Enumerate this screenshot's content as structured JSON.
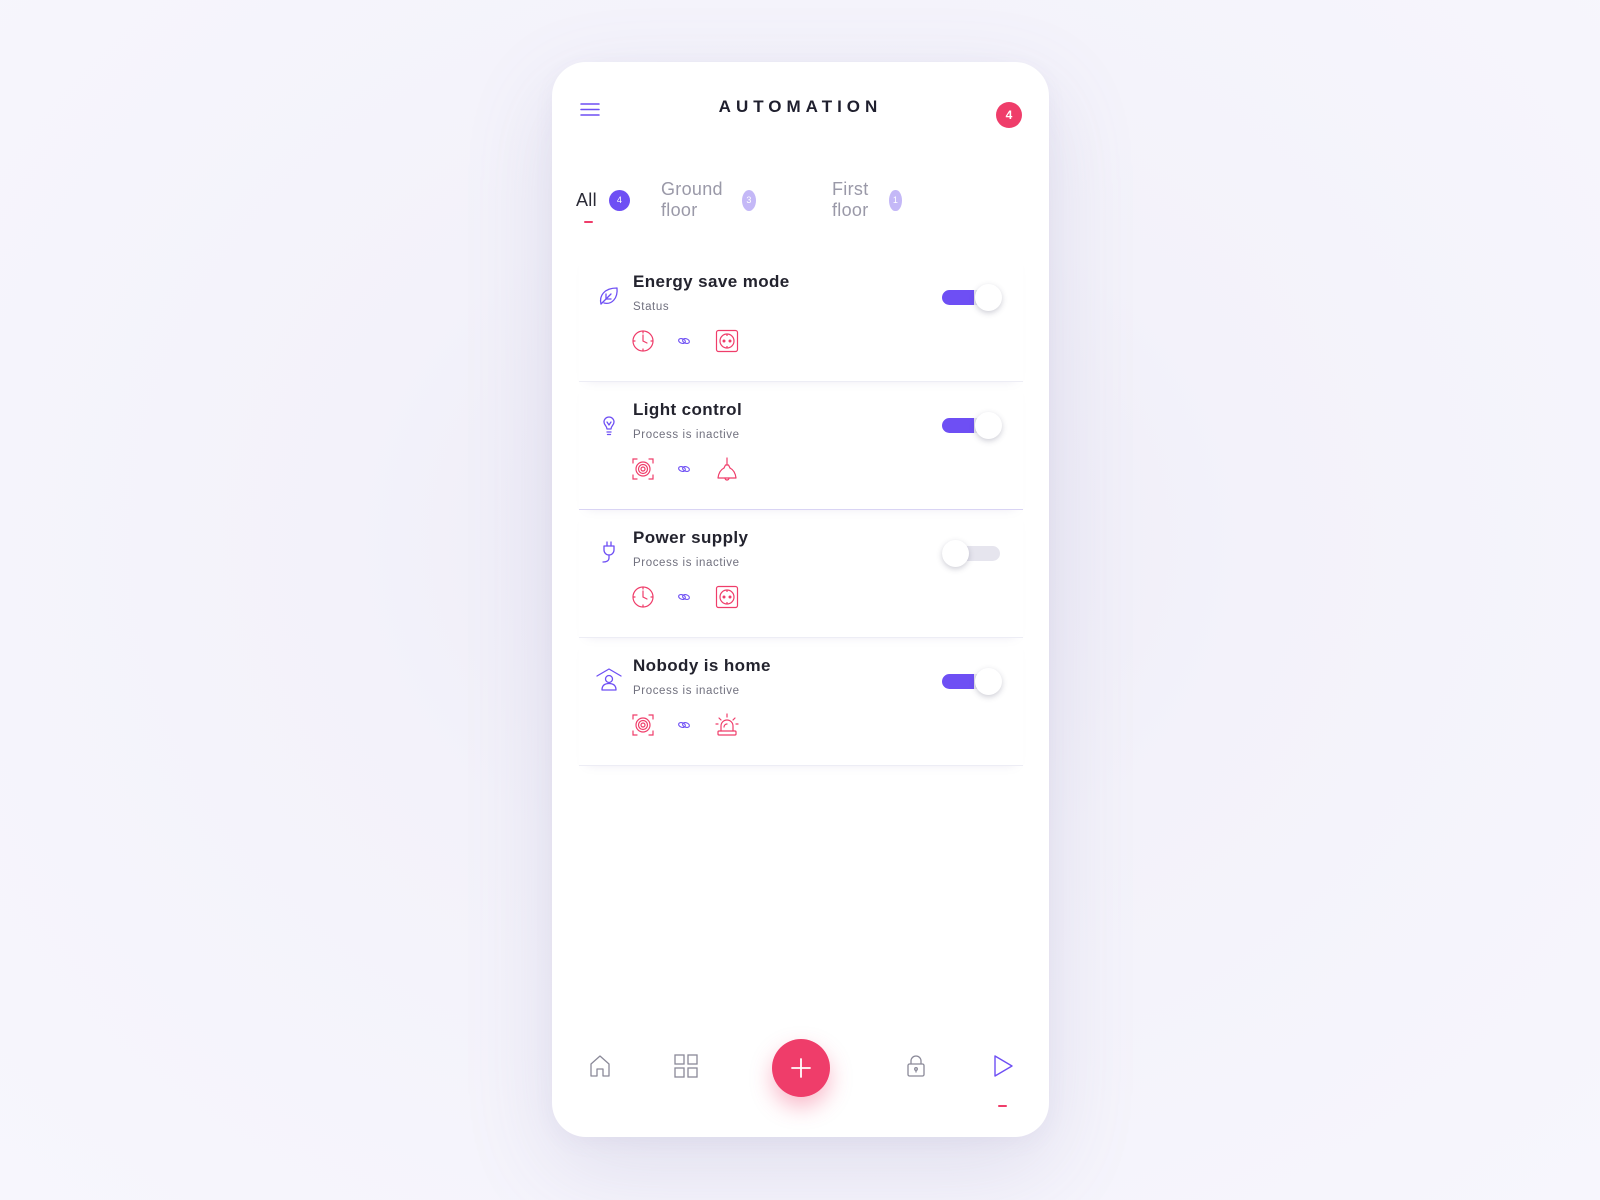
{
  "header": {
    "title": "AUTOMATION",
    "menu_icon": "hamburger-menu-icon",
    "notification_count": "4"
  },
  "tabs": [
    {
      "label": "All",
      "count": "4",
      "active": true
    },
    {
      "label": "Ground floor",
      "count": "3",
      "active": false
    },
    {
      "label": "First floor",
      "count": "1",
      "active": false
    }
  ],
  "automations": [
    {
      "name": "Energy save mode",
      "status": "Status",
      "icon": "leaf-icon",
      "enabled": true,
      "devices": [
        "clock-icon",
        "link-icon",
        "socket-icon"
      ]
    },
    {
      "name": "Light control",
      "status": "Process is inactive",
      "icon": "lightbulb-icon",
      "enabled": true,
      "devices": [
        "motion-sensor-icon",
        "link-icon",
        "lamp-icon"
      ]
    },
    {
      "name": "Power supply",
      "status": "Process is inactive",
      "icon": "plug-icon",
      "enabled": false,
      "devices": [
        "clock-icon",
        "link-icon",
        "socket-icon"
      ]
    },
    {
      "name": "Nobody is home",
      "status": "Process is inactive",
      "icon": "person-home-icon",
      "enabled": true,
      "devices": [
        "motion-sensor-icon",
        "link-icon",
        "alarm-siren-icon"
      ]
    }
  ],
  "bottom_nav": {
    "items": [
      "home-icon",
      "grid-icon",
      "add-icon",
      "lock-icon",
      "play-icon"
    ],
    "active": "play-icon"
  },
  "colors": {
    "accent": "#6e4ff4",
    "accent_light": "#c4b8f7",
    "pink": "#ef3d6a",
    "text": "#23232e",
    "muted": "#9a99a8"
  }
}
